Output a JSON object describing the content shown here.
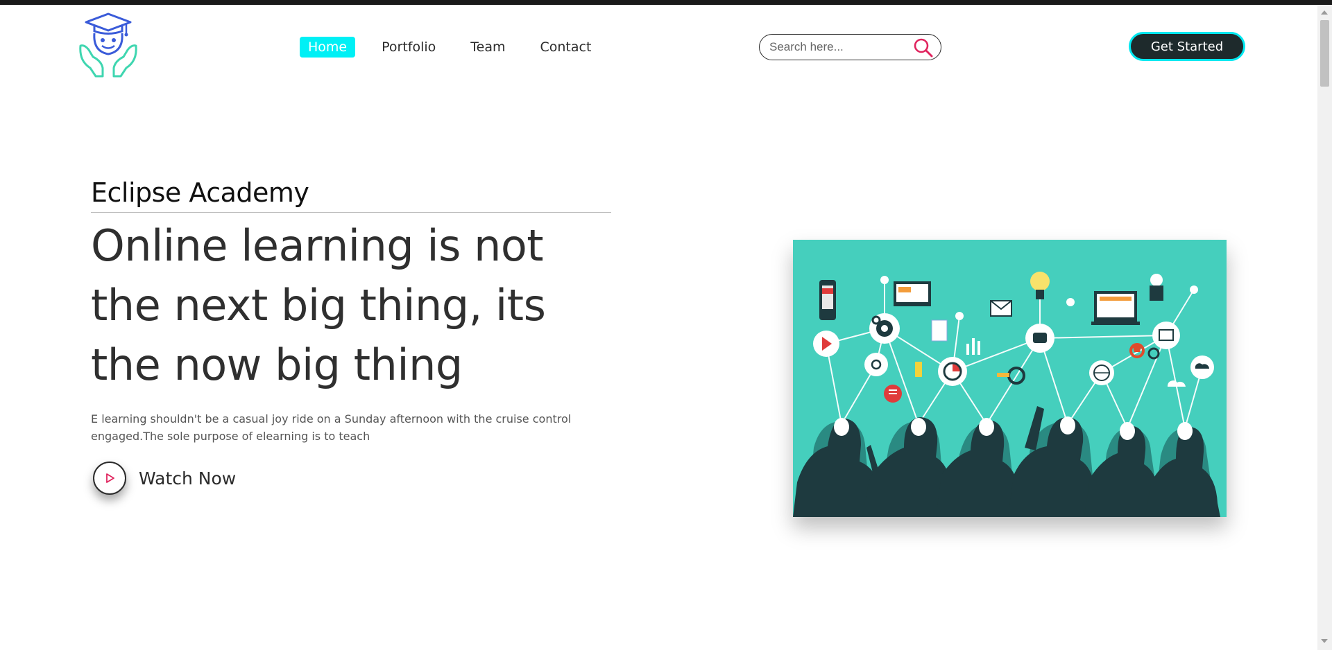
{
  "header": {
    "logo_icon": "graduate-hands-logo-icon",
    "nav": [
      {
        "label": "Home",
        "active": true
      },
      {
        "label": "Portfolio",
        "active": false
      },
      {
        "label": "Team",
        "active": false
      },
      {
        "label": "Contact",
        "active": false
      }
    ],
    "search": {
      "placeholder": "Search here...",
      "value": "",
      "icon": "search-icon"
    },
    "cta_label": "Get Started"
  },
  "hero": {
    "brand": "Eclipse Academy",
    "headline": "Online learning is not the next big thing, its the now big thing",
    "description": "E learning shouldn't be a casual joy ride on a Sunday afternoon with the cruise control engaged.The sole purpose of elearning is to teach",
    "watch_label": "Watch Now",
    "watch_icon": "play-icon",
    "image": "network-learning-illustration"
  },
  "colors": {
    "accent_cyan": "#00f0f5",
    "dark": "#1e2a2c",
    "illustration_bg": "#45cfbd",
    "search_icon": "#e0245e"
  }
}
